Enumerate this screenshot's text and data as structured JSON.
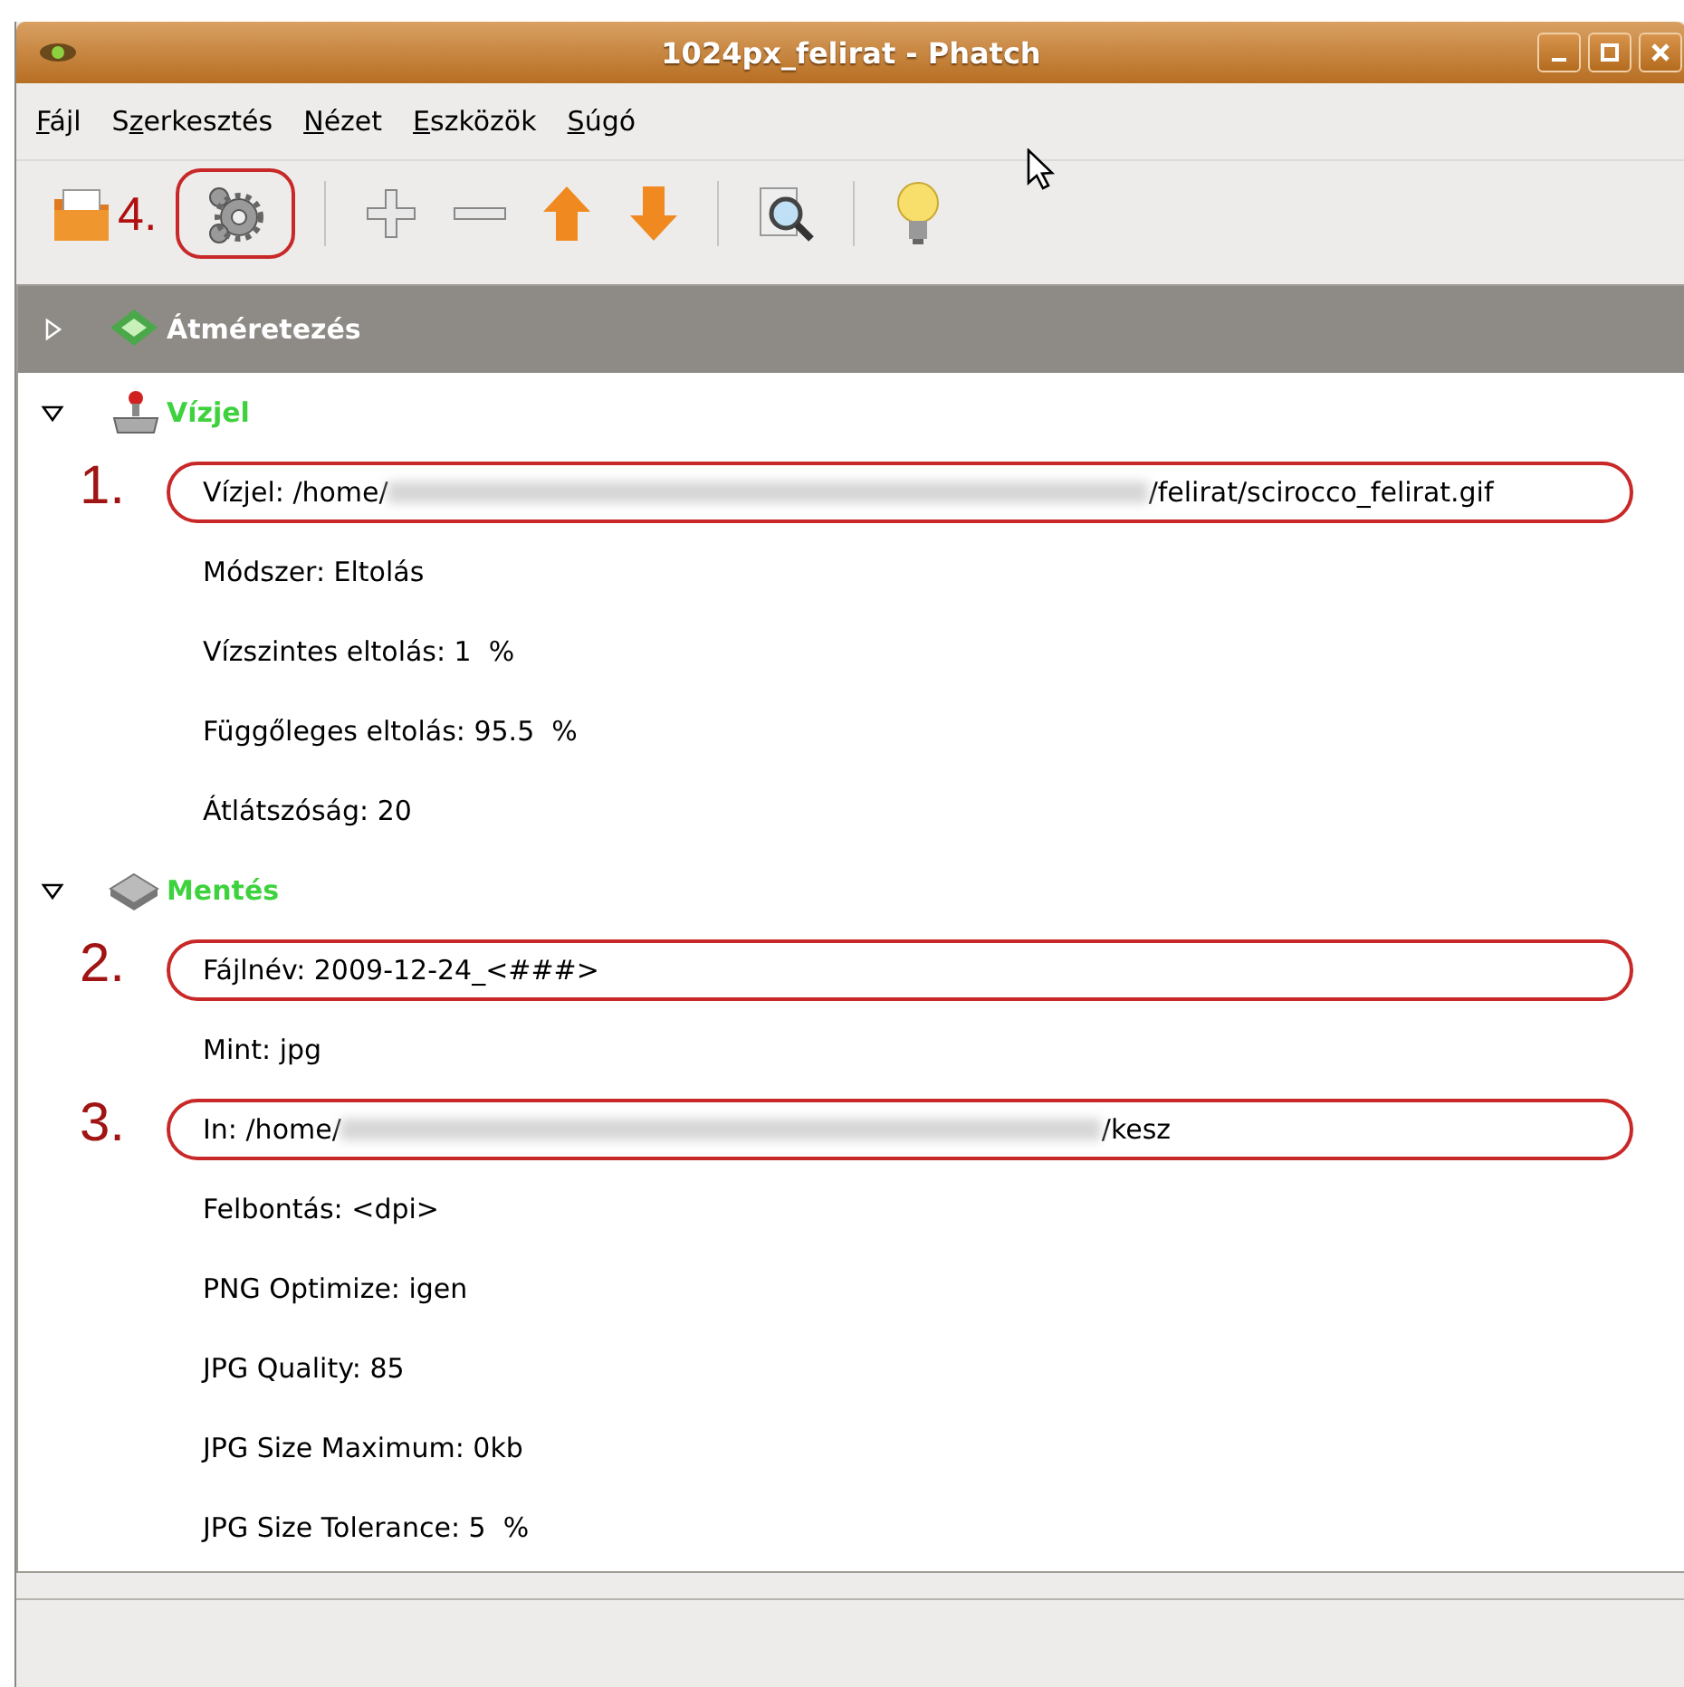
{
  "window": {
    "title": "1024px_felirat - Phatch"
  },
  "menu": [
    {
      "mnemonic": "F",
      "after": "ájl"
    },
    {
      "before": "S",
      "mnemonic": "z",
      "after": "erkesztés"
    },
    {
      "mnemonic": "N",
      "after": "ézet"
    },
    {
      "mnemonic": "E",
      "after": "szközök"
    },
    {
      "mnemonic": "S",
      "after": "úgó"
    }
  ],
  "toolbar": [
    {
      "kind": "open",
      "annotation": "4."
    },
    {
      "kind": "gear",
      "circled": true
    },
    {
      "kind": "separator"
    },
    {
      "kind": "plus"
    },
    {
      "kind": "minus"
    },
    {
      "kind": "up"
    },
    {
      "kind": "down"
    },
    {
      "kind": "separator"
    },
    {
      "kind": "preview"
    },
    {
      "kind": "separator"
    },
    {
      "kind": "bulb"
    }
  ],
  "actions": [
    {
      "label": "Átméretezés",
      "kind": "resize",
      "expanded": false,
      "selected": true
    },
    {
      "label": "Vízjel",
      "kind": "stamp",
      "expanded": true,
      "selected": false,
      "children": [
        {
          "text": "Vízjel: /home/",
          "redacted": true,
          "text_after": "/felirat/scirocco_felirat.gif",
          "annotation": "1."
        },
        {
          "text": "Módszer: Eltolás"
        },
        {
          "text": "Vízszintes eltolás: 1  %"
        },
        {
          "text": "Függőleges eltolás: 95.5  %"
        },
        {
          "text": "Átlátszóság: 20"
        }
      ]
    },
    {
      "label": "Mentés",
      "kind": "disk",
      "expanded": true,
      "selected": false,
      "children": [
        {
          "text": "Fájlnév: 2009-12-24_<###>",
          "annotation": "2."
        },
        {
          "text": "Mint: jpg"
        },
        {
          "text": "In: /home/",
          "redacted": true,
          "text_after": "/kesz",
          "annotation": "3."
        },
        {
          "text": "Felbontás: <dpi>"
        },
        {
          "text": "PNG Optimize: igen"
        },
        {
          "text": "JPG Quality: 85"
        },
        {
          "text": "JPG Size Maximum: 0kb"
        },
        {
          "text": "JPG Size Tolerance: 5  %"
        }
      ]
    }
  ]
}
